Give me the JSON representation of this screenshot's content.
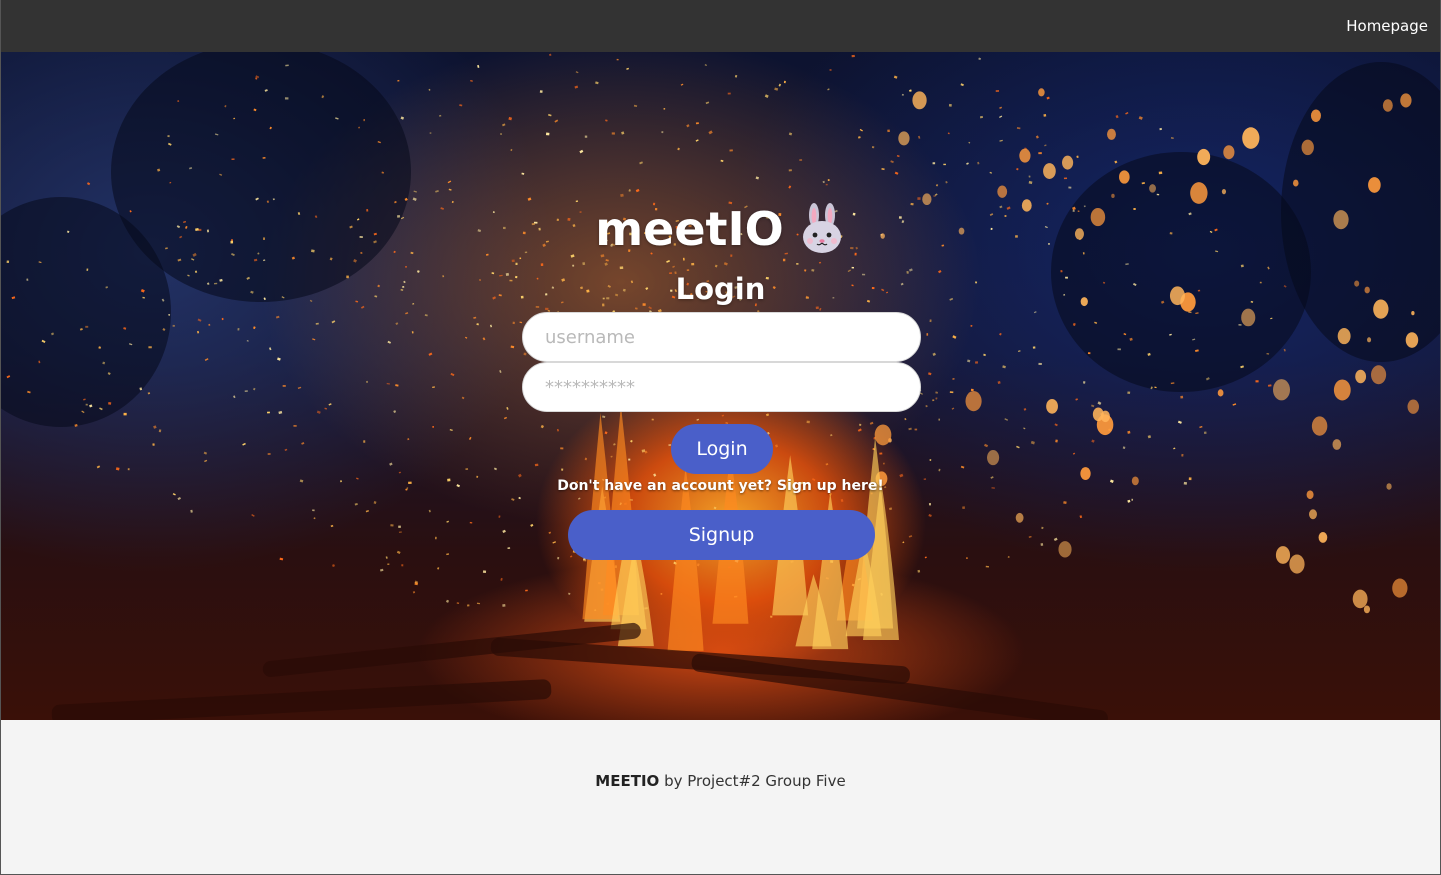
{
  "nav": {
    "homepage_label": "Homepage"
  },
  "brand": {
    "title": "meetIO",
    "emoji_icon": "rabbit-face-icon"
  },
  "login_form": {
    "heading": "Login",
    "username_placeholder": "username",
    "password_placeholder": "**********",
    "login_button": "Login",
    "signup_prompt": "Don't have an account yet? Sign up here!",
    "signup_button": "Signup"
  },
  "footer": {
    "brand": "MEETIO",
    "text": "by Project#2 Group Five"
  },
  "colors": {
    "navbar": "#333333",
    "button": "#4a5fc9",
    "footer_bg": "#f4f4f4"
  }
}
